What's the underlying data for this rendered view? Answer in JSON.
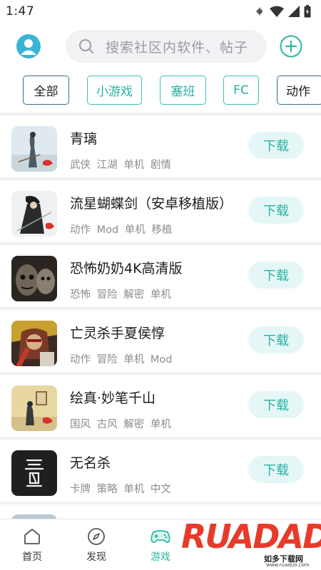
{
  "status": {
    "time": "1:47"
  },
  "header": {
    "search_placeholder": "搜索社区内软件、帖子"
  },
  "chips": [
    "全部",
    "小游戏",
    "塞班",
    "FC",
    "动作"
  ],
  "items": [
    {
      "title": "青璃",
      "tags": "武侠 江湖 单机 剧情",
      "button": "下载"
    },
    {
      "title": "流星蝴蝶剑（安卓移植版）",
      "tags": "动作 Mod 单机 移植",
      "button": "下载"
    },
    {
      "title": "恐怖奶奶4K高清版",
      "tags": "恐怖 冒险 解密 单机",
      "button": "下载"
    },
    {
      "title": "亡灵杀手夏侯惇",
      "tags": "动作 冒险 单机 Mod",
      "button": "下载"
    },
    {
      "title": "绘真·妙笔千山",
      "tags": "国风 古风 解密 单机",
      "button": "下载"
    },
    {
      "title": "无名杀",
      "tags": "卡牌 策略 单机 中文",
      "button": "下载"
    }
  ],
  "tabs": [
    {
      "label": "首页",
      "icon": "home-icon"
    },
    {
      "label": "发现",
      "icon": "compass-icon"
    },
    {
      "label": "游戏",
      "icon": "gamepad-icon"
    }
  ],
  "watermark": {
    "logo": "RUADADO",
    "sub": "如多下载网",
    "url": "www.ruaduo.com"
  },
  "colors": {
    "accent": "#2bb7a5",
    "download_bg": "#e5f6f6",
    "watermark_red": "#e83a2a"
  }
}
